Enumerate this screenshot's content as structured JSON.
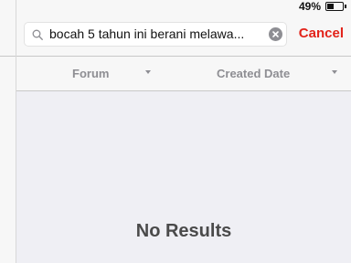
{
  "status": {
    "battery_percent": "49%"
  },
  "search": {
    "query": "bocah 5 tahun ini berani melawa...",
    "cancel_label": "Cancel"
  },
  "columns": [
    {
      "label": "Forum"
    },
    {
      "label": "Created Date"
    }
  ],
  "results": {
    "empty_message": "No Results"
  },
  "colors": {
    "accent": "#e2231a",
    "header_text": "#8e8e93",
    "background": "#efeff4"
  }
}
